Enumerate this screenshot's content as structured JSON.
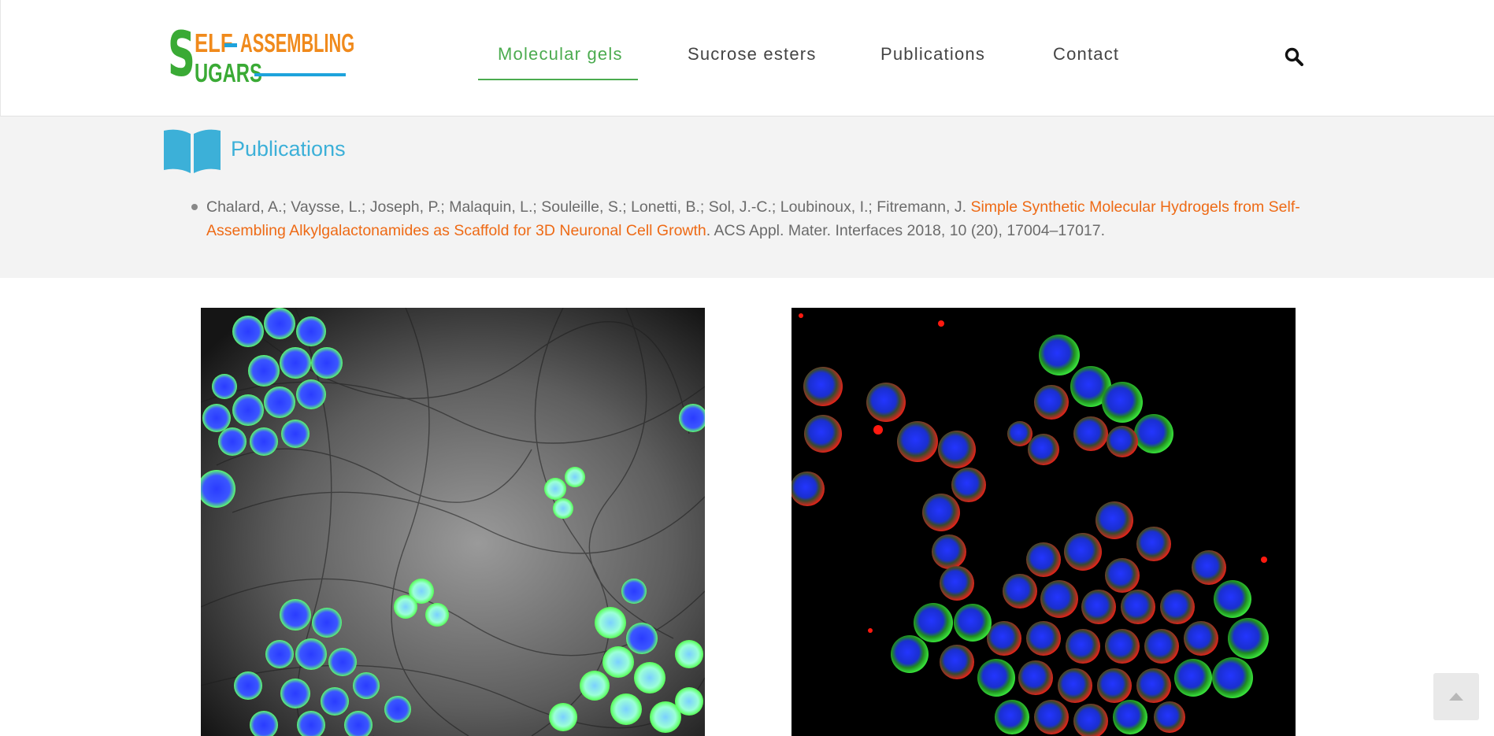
{
  "logo": {
    "big_s": "S",
    "line1_part1": "ELF",
    "line1_part2": "ASSEMBLING",
    "line2": "UGARS"
  },
  "nav": {
    "items": [
      {
        "label": "Molecular gels",
        "active": true
      },
      {
        "label": "Sucrose esters",
        "active": false
      },
      {
        "label": "Publications",
        "active": false
      },
      {
        "label": "Contact",
        "active": false
      }
    ]
  },
  "section": {
    "title": "Publications"
  },
  "publications": [
    {
      "authors": "Chalard, A.; Vaysse, L.; Joseph, P.; Malaquin, L.; Souleille, S.; Lonetti, B.; Sol, J.-C.; Loubinoux, I.; Fitremann, J.",
      "title": "Simple Synthetic Molecular Hydrogels from Self-Assembling Alkylgalactonamides as Scaffold for 3D Neuronal Cell Growth",
      "citation": ". ACS Appl. Mater. Interfaces 2018, 10 (20), 17004–17017."
    }
  ],
  "colors": {
    "accent_green": "#4bab4f",
    "accent_blue": "#3cb0d8",
    "link_orange": "#ee6a15",
    "band_bg": "#f3f3f3"
  },
  "icons": {
    "search": "search-icon",
    "book": "book-icon",
    "scroll_top": "chevron-up-icon"
  }
}
